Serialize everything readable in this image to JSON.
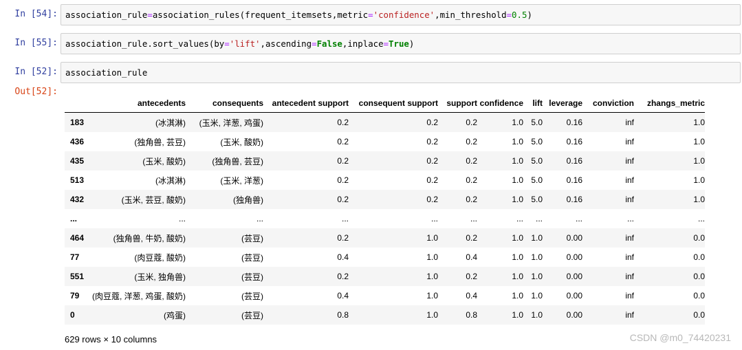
{
  "cells": [
    {
      "prompt": "In  [54]:",
      "code": [
        {
          "t": "association_rule",
          "c": ""
        },
        {
          "t": "=",
          "c": "op"
        },
        {
          "t": "association_rules(frequent_itemsets,metric",
          "c": ""
        },
        {
          "t": "=",
          "c": "op"
        },
        {
          "t": "'confidence'",
          "c": "str"
        },
        {
          "t": ",min_threshold",
          "c": ""
        },
        {
          "t": "=",
          "c": "op"
        },
        {
          "t": "0.5",
          "c": "num"
        },
        {
          "t": ")",
          "c": ""
        }
      ]
    },
    {
      "prompt": "In  [55]:",
      "code": [
        {
          "t": "association_rule.sort_values(by",
          "c": ""
        },
        {
          "t": "=",
          "c": "op"
        },
        {
          "t": "'lift'",
          "c": "str"
        },
        {
          "t": ",ascending",
          "c": ""
        },
        {
          "t": "=",
          "c": "op"
        },
        {
          "t": "False",
          "c": "kw"
        },
        {
          "t": ",inplace",
          "c": ""
        },
        {
          "t": "=",
          "c": "op"
        },
        {
          "t": "True",
          "c": "kw"
        },
        {
          "t": ")",
          "c": ""
        }
      ]
    },
    {
      "prompt": "In  [52]:",
      "code": [
        {
          "t": "association_rule",
          "c": ""
        }
      ]
    }
  ],
  "output_prompt": "Out[52]:",
  "table": {
    "columns": [
      "antecedents",
      "consequents",
      "antecedent support",
      "consequent support",
      "support",
      "confidence",
      "lift",
      "leverage",
      "conviction",
      "zhangs_metric"
    ],
    "rows": [
      [
        "183",
        "(冰淇淋)",
        "(玉米, 洋葱, 鸡蛋)",
        "0.2",
        "0.2",
        "0.2",
        "1.0",
        "5.0",
        "0.16",
        "inf",
        "1.0"
      ],
      [
        "436",
        "(独角兽, 芸豆)",
        "(玉米, 酸奶)",
        "0.2",
        "0.2",
        "0.2",
        "1.0",
        "5.0",
        "0.16",
        "inf",
        "1.0"
      ],
      [
        "435",
        "(玉米, 酸奶)",
        "(独角兽, 芸豆)",
        "0.2",
        "0.2",
        "0.2",
        "1.0",
        "5.0",
        "0.16",
        "inf",
        "1.0"
      ],
      [
        "513",
        "(冰淇淋)",
        "(玉米, 洋葱)",
        "0.2",
        "0.2",
        "0.2",
        "1.0",
        "5.0",
        "0.16",
        "inf",
        "1.0"
      ],
      [
        "432",
        "(玉米, 芸豆, 酸奶)",
        "(独角兽)",
        "0.2",
        "0.2",
        "0.2",
        "1.0",
        "5.0",
        "0.16",
        "inf",
        "1.0"
      ],
      [
        "...",
        "...",
        "...",
        "...",
        "...",
        "...",
        "...",
        "...",
        "...",
        "...",
        "..."
      ],
      [
        "464",
        "(独角兽, 牛奶, 酸奶)",
        "(芸豆)",
        "0.2",
        "1.0",
        "0.2",
        "1.0",
        "1.0",
        "0.00",
        "inf",
        "0.0"
      ],
      [
        "77",
        "(肉豆蔻, 酸奶)",
        "(芸豆)",
        "0.4",
        "1.0",
        "0.4",
        "1.0",
        "1.0",
        "0.00",
        "inf",
        "0.0"
      ],
      [
        "551",
        "(玉米, 独角兽)",
        "(芸豆)",
        "0.2",
        "1.0",
        "0.2",
        "1.0",
        "1.0",
        "0.00",
        "inf",
        "0.0"
      ],
      [
        "79",
        "(肉豆蔻, 洋葱, 鸡蛋, 酸奶)",
        "(芸豆)",
        "0.4",
        "1.0",
        "0.4",
        "1.0",
        "1.0",
        "0.00",
        "inf",
        "0.0"
      ],
      [
        "0",
        "(鸡蛋)",
        "(芸豆)",
        "0.8",
        "1.0",
        "0.8",
        "1.0",
        "1.0",
        "0.00",
        "inf",
        "0.0"
      ]
    ]
  },
  "shape_text": "629 rows × 10 columns",
  "watermark": "CSDN @m0_74420231"
}
